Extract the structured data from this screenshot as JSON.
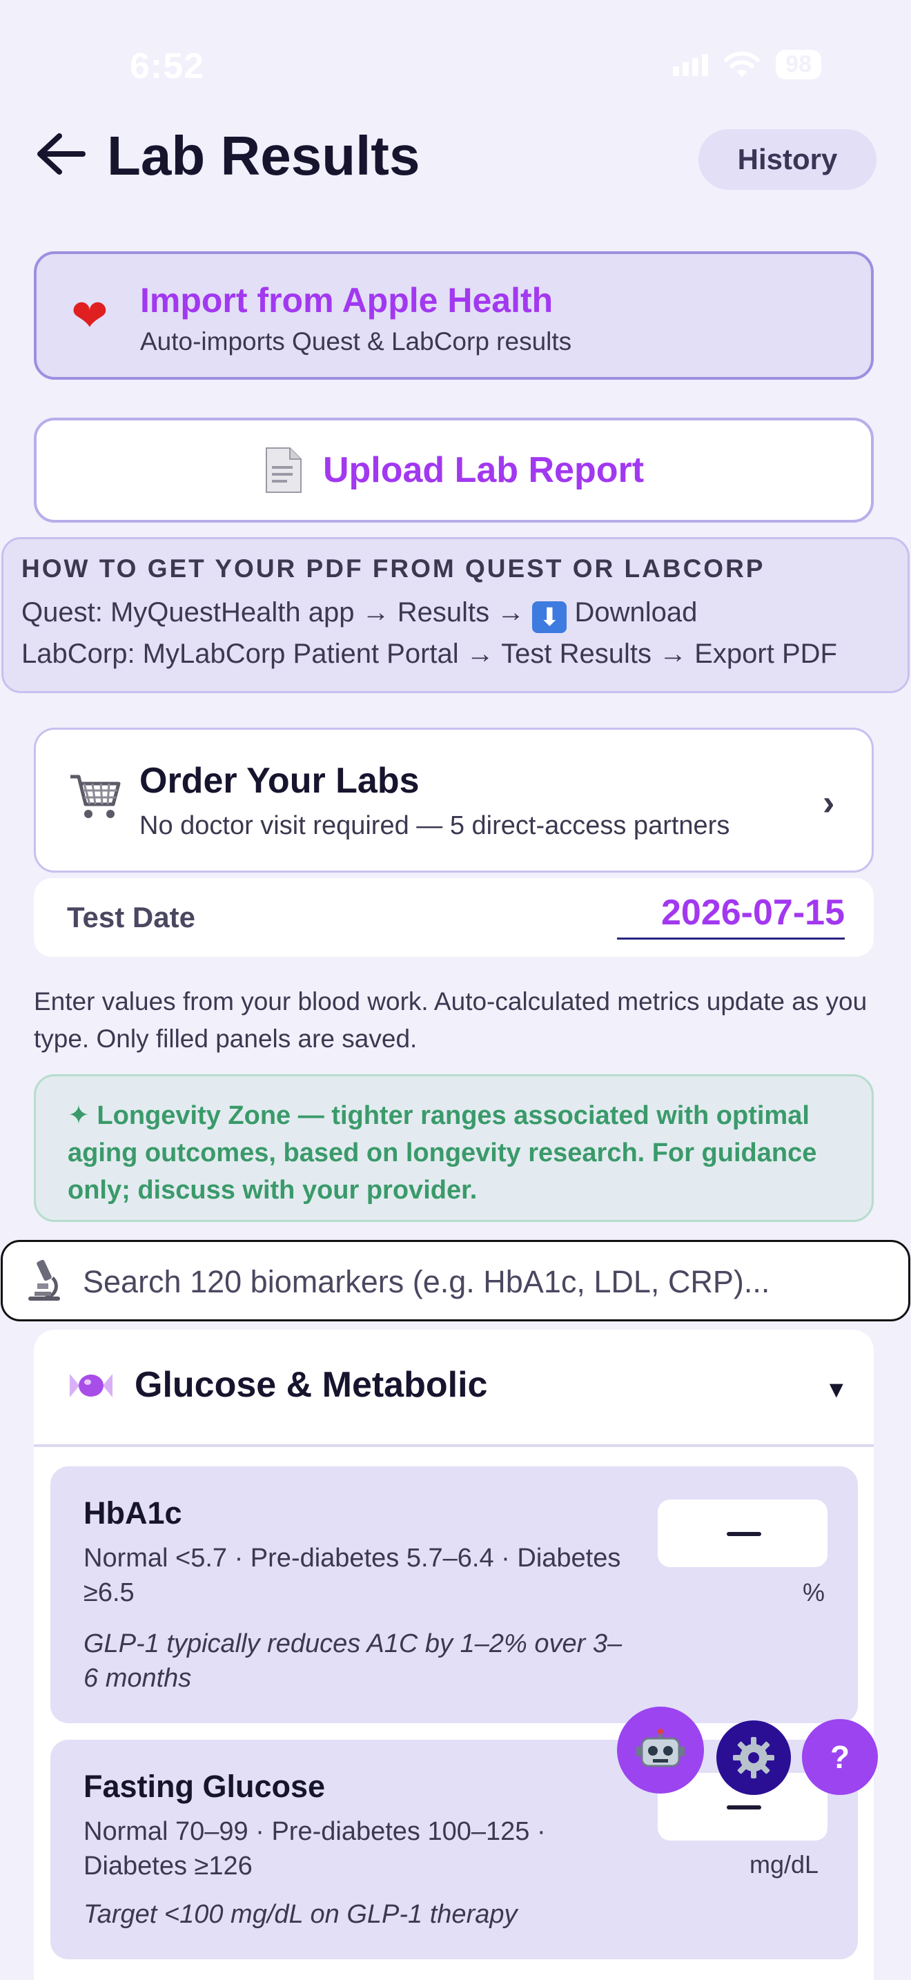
{
  "status_bar": {
    "time": "6:52",
    "battery": "98"
  },
  "header": {
    "title": "Lab Results",
    "history_label": "History"
  },
  "import_card": {
    "title": "Import from Apple Health",
    "subtitle": "Auto-imports Quest & LabCorp results"
  },
  "upload": {
    "label": "Upload Lab Report"
  },
  "howto": {
    "title": "HOW TO GET YOUR PDF FROM QUEST OR LABCORP",
    "quest_prefix": "Quest: MyQuestHealth app → Results →",
    "quest_suffix": "Download",
    "labcorp": "LabCorp: MyLabCorp Patient Portal → Test Results → Export PDF"
  },
  "order_card": {
    "title": "Order Your Labs",
    "subtitle": "No doctor visit required — 5 direct-access partners"
  },
  "test_date": {
    "label": "Test Date",
    "value": "2026-07-15"
  },
  "intro_text": "Enter values from your blood work. Auto-calculated metrics update as you type. Only filled panels are saved.",
  "longevity_note": "✦ Longevity Zone — tighter ranges associated with optimal aging outcomes, based on longevity research. For guidance only; discuss with your provider.",
  "search": {
    "placeholder": "Search 120 biomarkers (e.g. HbA1c, LDL, CRP)..."
  },
  "section": {
    "title": "Glucose & Metabolic",
    "markers": [
      {
        "name": "HbA1c",
        "range": "Normal <5.7 · Pre-diabetes 5.7–6.4 · Diabetes ≥6.5",
        "note": "GLP-1 typically reduces A1C by 1–2% over 3–6 months",
        "unit": "%"
      },
      {
        "name": "Fasting Glucose",
        "range": "Normal 70–99 · Pre-diabetes 100–125 · Diabetes ≥126",
        "note": "Target <100 mg/dL on GLP-1 therapy",
        "unit": "mg/dL"
      }
    ]
  },
  "fabs": {
    "help_label": "?"
  },
  "colors": {
    "accent": "#a238f0",
    "background": "#f1f0fb",
    "longevity_green": "#3a9a6a",
    "fab_gear": "#2a0f95"
  },
  "icons": [
    "back-arrow-icon",
    "heart-icon",
    "document-icon",
    "download-icon",
    "cart-icon",
    "chevron-right-icon",
    "microscope-icon",
    "candy-icon",
    "dropdown-icon",
    "robot-icon",
    "gear-icon",
    "help-icon"
  ]
}
